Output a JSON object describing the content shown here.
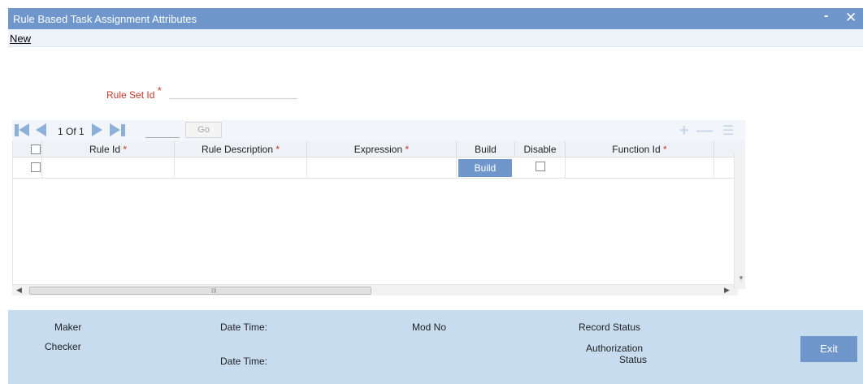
{
  "window": {
    "title": "Rule Based Task Assignment Attributes",
    "minimize": "-",
    "close": "✕"
  },
  "menu": {
    "new_label": "New"
  },
  "form": {
    "rule_set_id_label": "Rule Set Id",
    "required_mark": "*",
    "rule_set_id_value": ""
  },
  "pager": {
    "text": "1 Of 1",
    "page_value": "",
    "go_label": "Go"
  },
  "toolbar_icons": {
    "add": "add-row-icon",
    "delete": "delete-row-icon",
    "list": "list-view-icon"
  },
  "grid": {
    "columns": [
      {
        "label": "Rule Id",
        "star": "*"
      },
      {
        "label": "Rule Description",
        "star": "*"
      },
      {
        "label": "Expression",
        "star": "*"
      },
      {
        "label": "Build",
        "star": ""
      },
      {
        "label": "Disable",
        "star": ""
      },
      {
        "label": "Function Id",
        "star": "*"
      }
    ],
    "rows": [
      {
        "rule_id": "",
        "rule_description": "",
        "expression": "",
        "build_label": "Build",
        "function_id": ""
      }
    ],
    "scroll_grip": "III"
  },
  "footer": {
    "maker": "Maker",
    "checker": "Checker",
    "date_time_1": "Date Time:",
    "date_time_2": "Date Time:",
    "mod_no": "Mod No",
    "record_status": "Record Status",
    "authorization_status_1": "Authorization",
    "authorization_status_2": "Status",
    "exit_label": "Exit"
  },
  "colors": {
    "titlebar": "#6f97cc",
    "footer": "#c7dcef",
    "required": "#c0392b",
    "button": "#6f97cc"
  }
}
